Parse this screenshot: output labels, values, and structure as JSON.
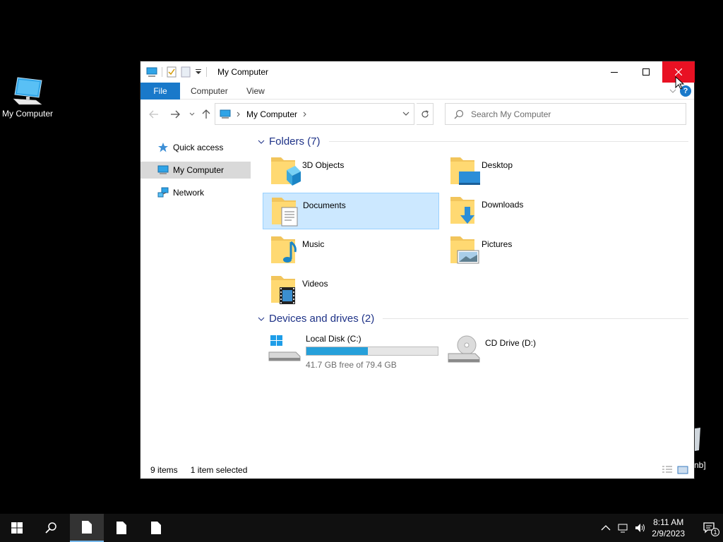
{
  "desktop": {
    "icon_label": "My Computer",
    "partial_text": "nb]"
  },
  "window": {
    "title": "My Computer",
    "ribbon": {
      "tabs": [
        "File",
        "Computer",
        "View"
      ]
    },
    "address": {
      "crumb": "My Computer",
      "search_placeholder": "Search My Computer"
    },
    "nav_pane": {
      "items": [
        {
          "label": "Quick access",
          "icon": "star-icon"
        },
        {
          "label": "My Computer",
          "icon": "computer-icon",
          "selected": true
        },
        {
          "label": "Network",
          "icon": "network-icon"
        }
      ]
    },
    "folders": {
      "header": "Folders (7)",
      "items": [
        {
          "label": "3D Objects",
          "icon": "3d-objects-folder-icon"
        },
        {
          "label": "Desktop",
          "icon": "desktop-folder-icon"
        },
        {
          "label": "Documents",
          "icon": "documents-folder-icon",
          "selected": true
        },
        {
          "label": "Downloads",
          "icon": "downloads-folder-icon"
        },
        {
          "label": "Music",
          "icon": "music-folder-icon"
        },
        {
          "label": "Pictures",
          "icon": "pictures-folder-icon"
        },
        {
          "label": "Videos",
          "icon": "videos-folder-icon"
        }
      ]
    },
    "drives": {
      "header": "Devices and drives (2)",
      "items": [
        {
          "label": "Local Disk (C:)",
          "free_text": "41.7 GB free of 79.4 GB",
          "used_fraction": 0.47,
          "icon": "windows-drive-icon"
        },
        {
          "label": "CD Drive (D:)",
          "icon": "cd-drive-icon"
        }
      ]
    },
    "status": {
      "count": "9 items",
      "selection": "1 item selected"
    }
  },
  "taskbar": {
    "time": "8:11 AM",
    "date": "2/9/2023",
    "notification_count": "1"
  },
  "colors": {
    "accent": "#1979ca",
    "close_red": "#e81123",
    "selection": "#cce8ff",
    "group_header": "#1e3287",
    "drive_bar": "#26a0da"
  }
}
